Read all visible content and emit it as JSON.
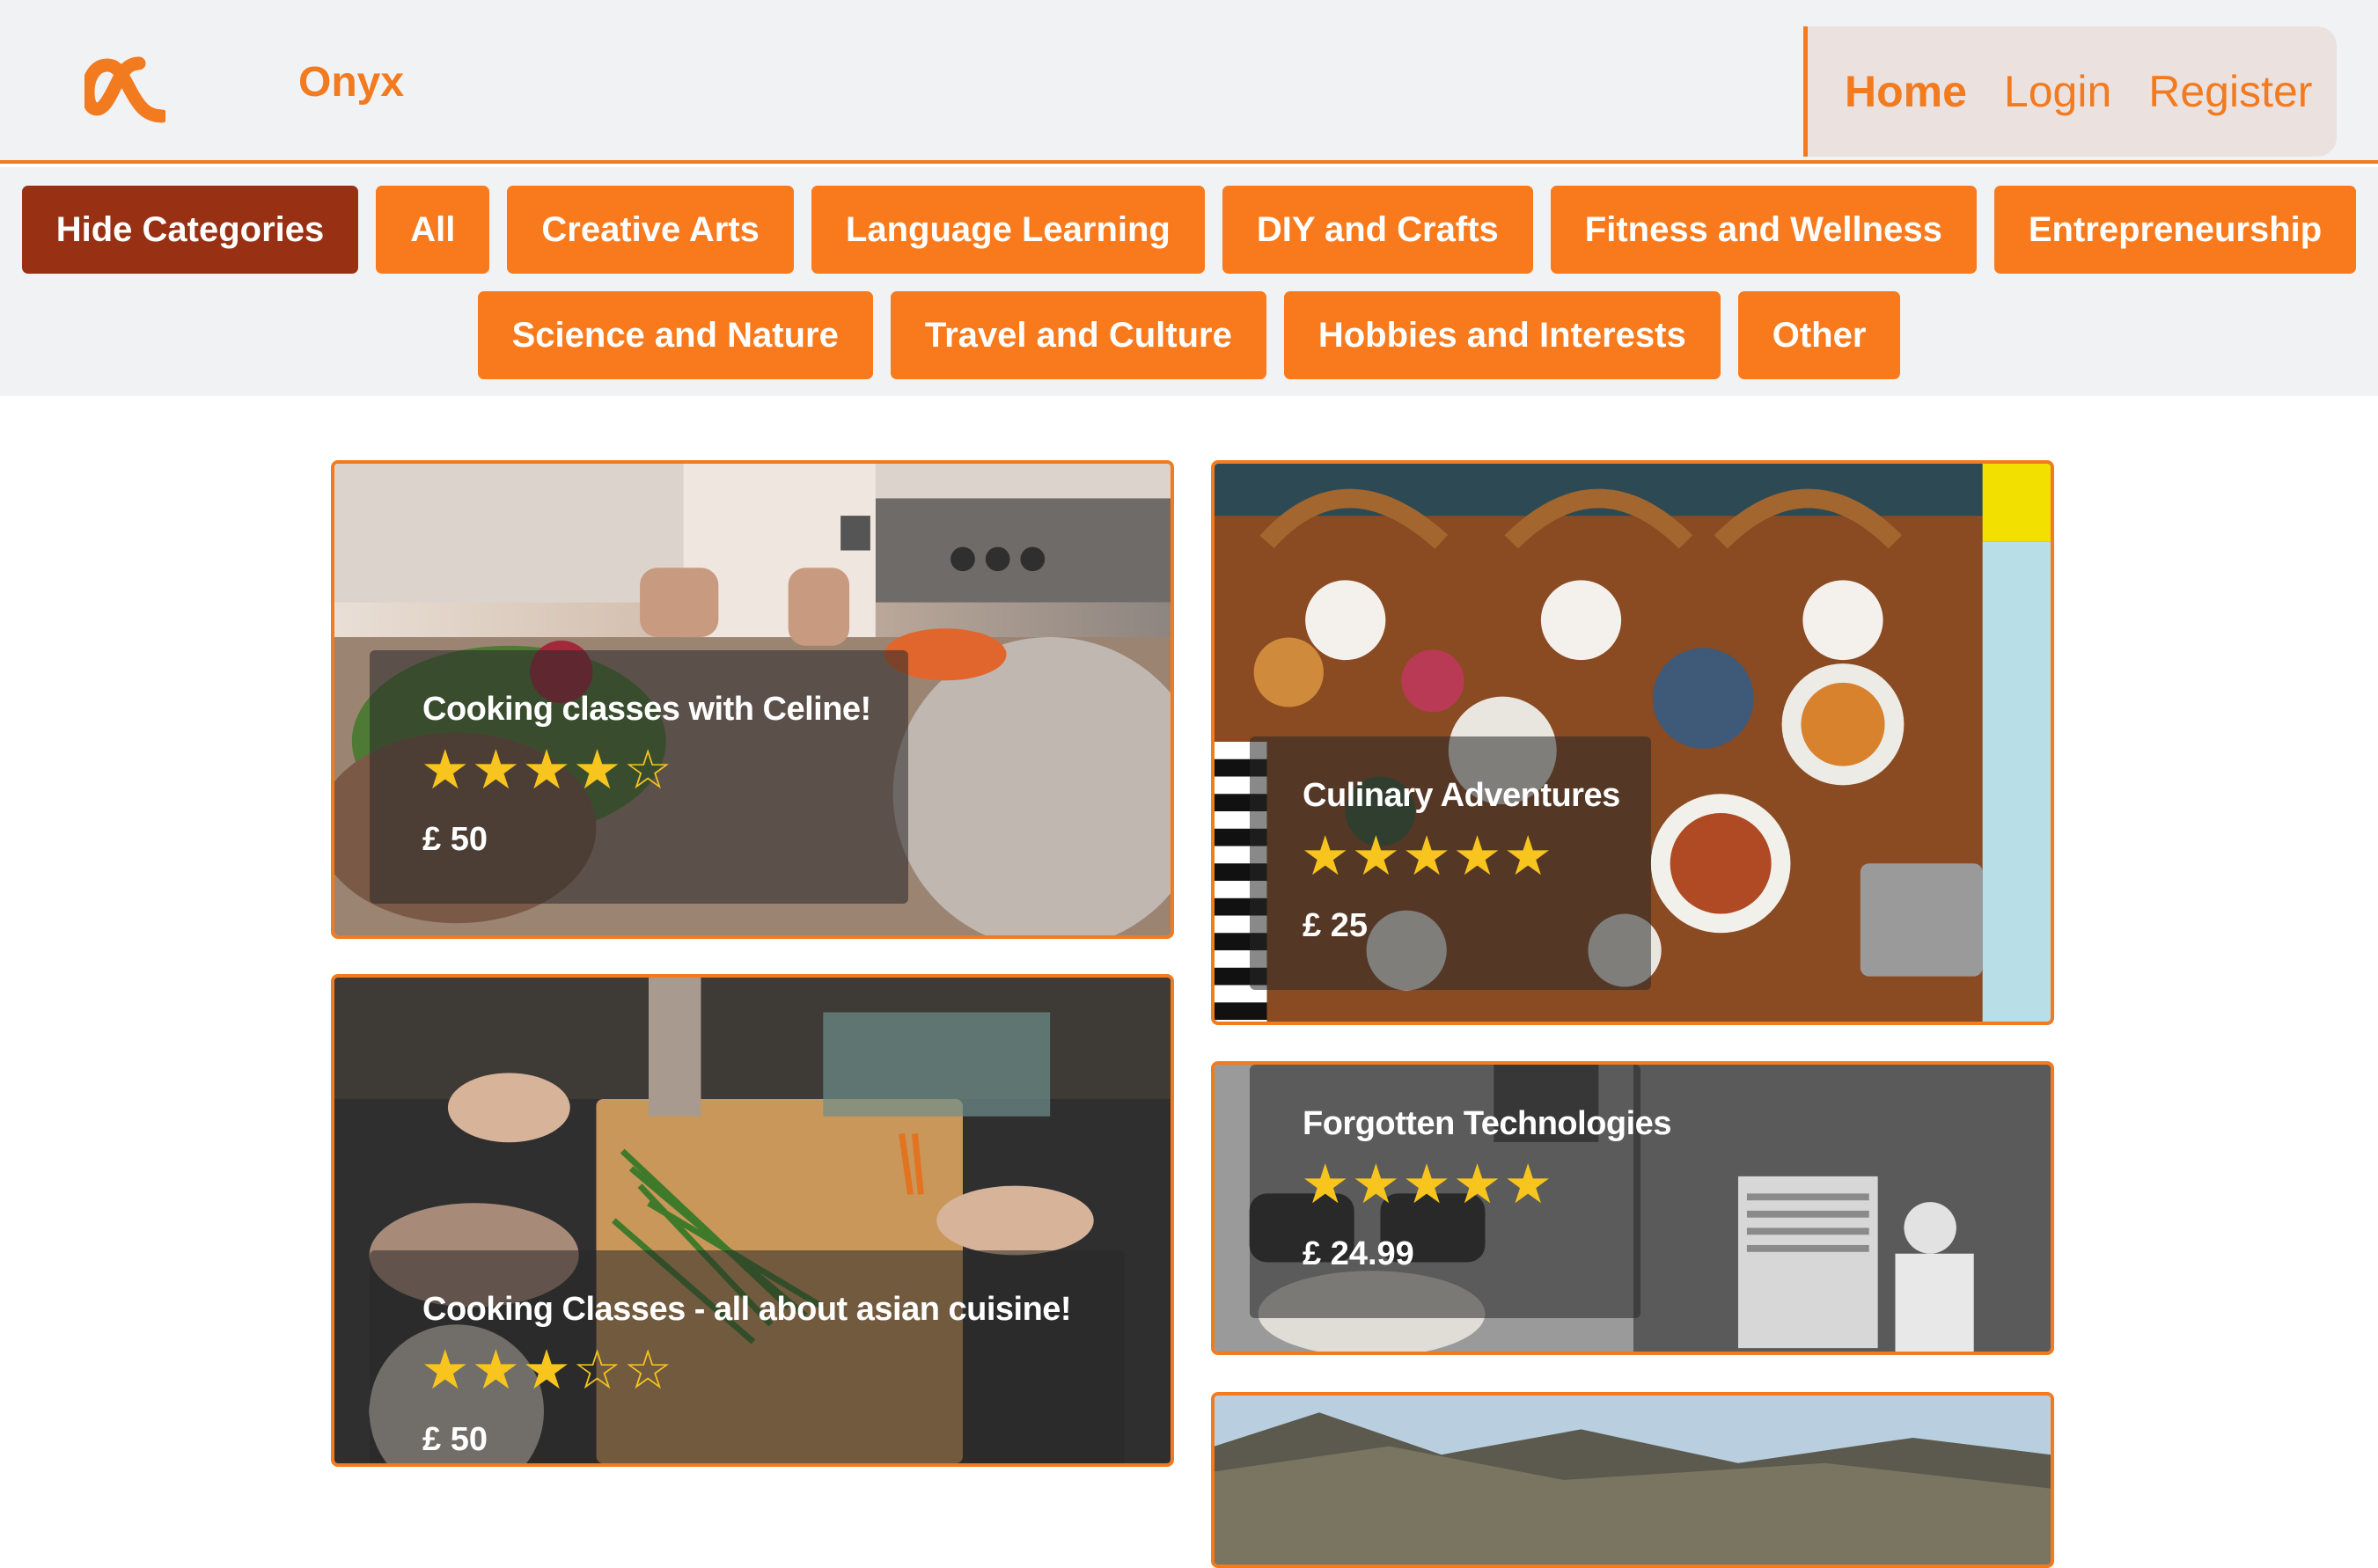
{
  "header": {
    "brand": "Onyx",
    "logo_icon": "alpha-logo-icon",
    "nav": [
      {
        "label": "Home",
        "active": true
      },
      {
        "label": "Login",
        "active": false
      },
      {
        "label": "Register",
        "active": false
      }
    ]
  },
  "categories": {
    "toggle_label": "Hide Categories",
    "row1": [
      "All",
      "Creative Arts",
      "Language Learning",
      "DIY and Crafts",
      "Fitness and Wellness",
      "Entrepreneurship"
    ],
    "row2": [
      "Science and Nature",
      "Travel and Culture",
      "Hobbies and Interests",
      "Other"
    ]
  },
  "cards": [
    {
      "title": "Cooking classes with Celine!",
      "rating": 4,
      "max_rating": 5,
      "price": "£ 50"
    },
    {
      "title": "Culinary Adventures",
      "rating": 5,
      "max_rating": 5,
      "price": "£ 25"
    },
    {
      "title": "Cooking Classes - all about asian cuisine!",
      "rating": 3,
      "max_rating": 5,
      "price": "£ 50"
    },
    {
      "title": "Forgotten Technologies",
      "rating": 5,
      "max_rating": 5,
      "price": "£ 24.99"
    }
  ],
  "colors": {
    "accent": "#f27a1f",
    "category_button": "#f97a1c",
    "hide_button": "#983114",
    "star": "#f7c51d",
    "header_bg": "#f1f2f4",
    "nav_bg": "#ebe2e0"
  }
}
